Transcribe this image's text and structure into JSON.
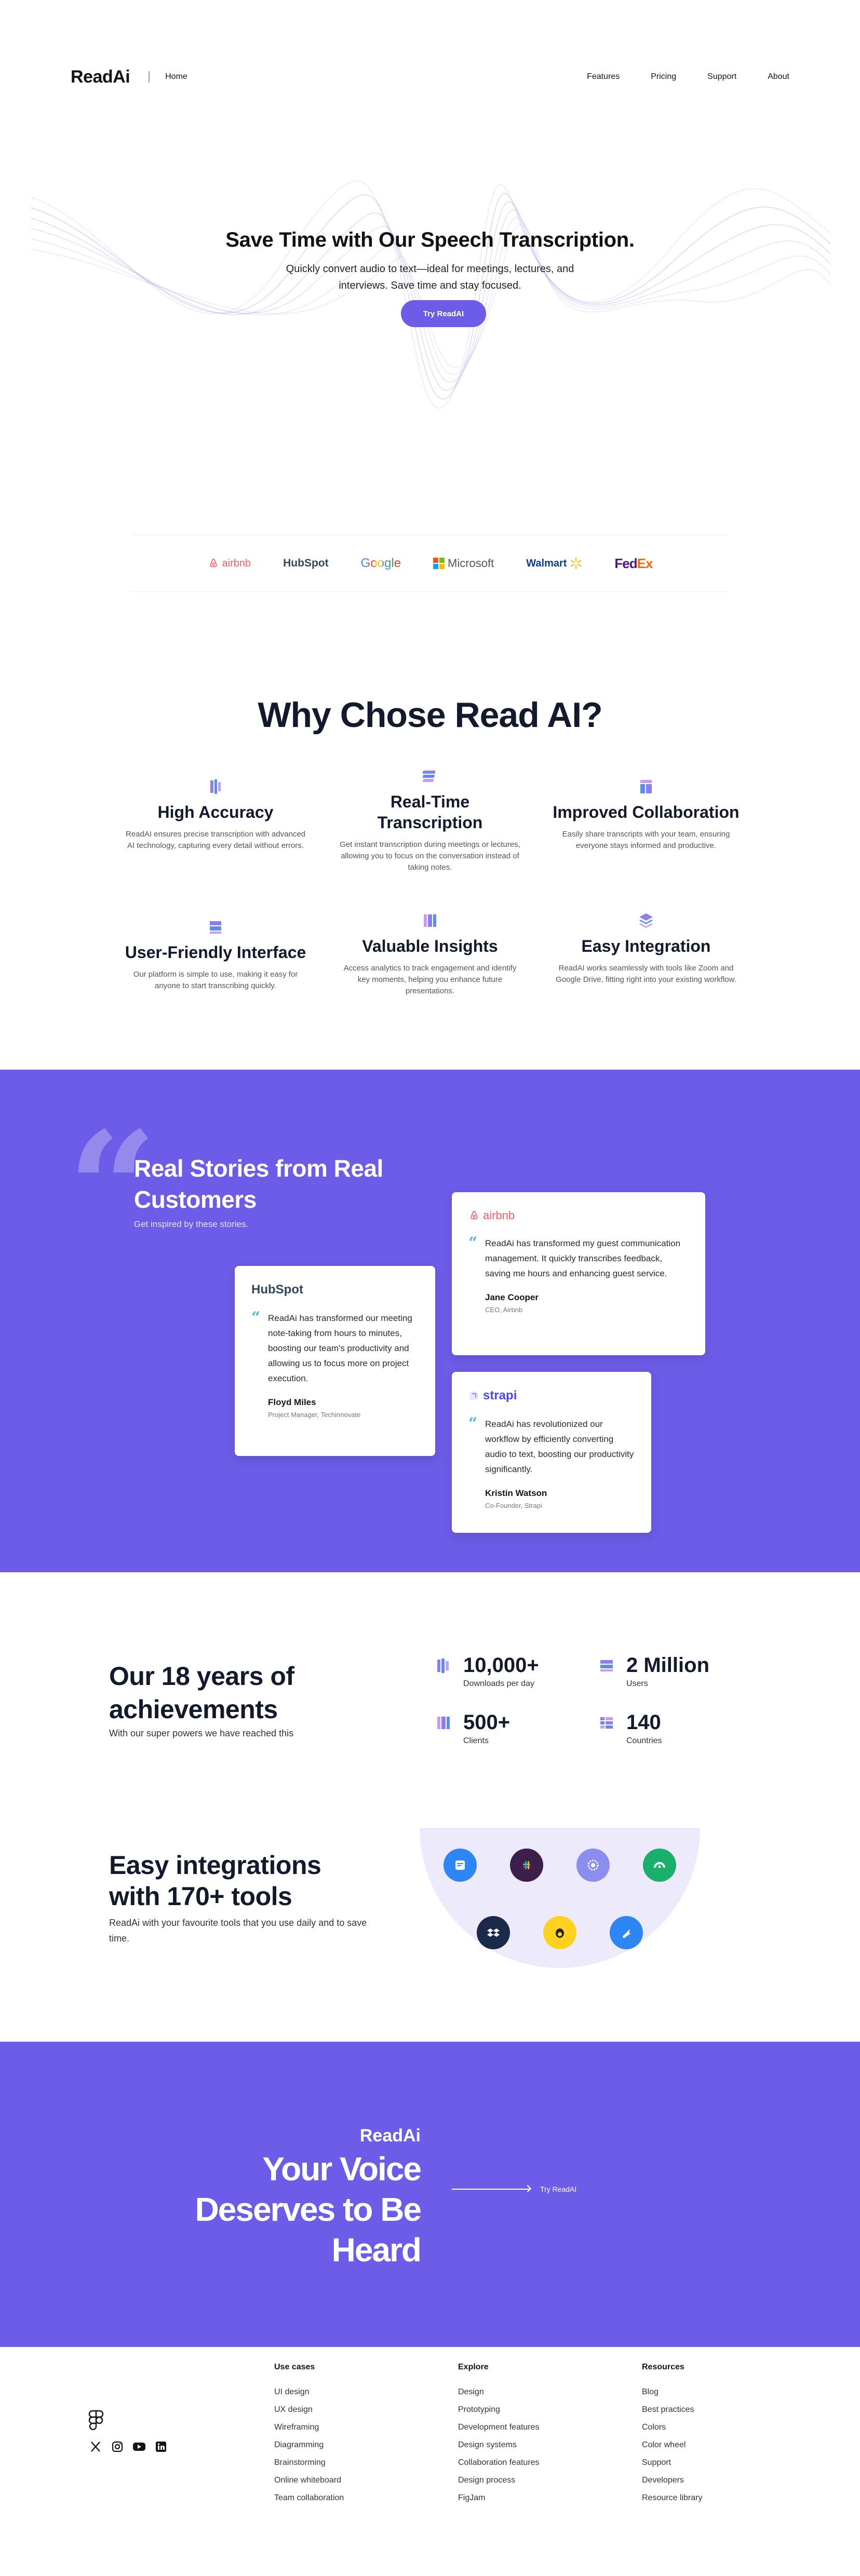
{
  "nav": {
    "logo": "ReadAi",
    "home": "Home",
    "links": [
      "Features",
      "Pricing",
      "Support",
      "About"
    ]
  },
  "hero": {
    "title": "Save Time with Our Speech Transcription.",
    "subtitle": "Quickly convert audio to text—ideal for meetings, lectures, and interviews. Save time and stay focused.",
    "cta": "Try ReadAI"
  },
  "logos": [
    "airbnb",
    "HubSpot",
    "Google",
    "Microsoft",
    "Walmart",
    "FedEx"
  ],
  "why": {
    "title": "Why Chose Read AI?",
    "features": [
      {
        "title": "High Accuracy",
        "text": "ReadAI ensures precise transcription with advanced AI technology, capturing every detail without errors."
      },
      {
        "title": "Real-Time Transcription",
        "text": "Get instant transcription during meetings or lectures, allowing you to focus on the conversation instead of taking notes."
      },
      {
        "title": "Improved Collaboration",
        "text": "Easily share transcripts with your team, ensuring everyone stays informed and productive."
      },
      {
        "title": "User-Friendly Interface",
        "text": "Our platform is simple to use, making it easy for anyone to start transcribing quickly."
      },
      {
        "title": "Valuable Insights",
        "text": "Access analytics to track engagement and identify key moments, helping you enhance future presentations."
      },
      {
        "title": "Easy Integration",
        "text": "ReadAI works seamlessly with tools like Zoom and Google Drive, fitting right into your existing workflow."
      }
    ]
  },
  "stories": {
    "title": "Real Stories from Real Customers",
    "subtitle": "Get inspired by these stories.",
    "testimonials": [
      {
        "brand": "HubSpot",
        "text": "ReadAi has transformed our meeting note-taking from hours to minutes, boosting our team's productivity and allowing us to focus more on project execution.",
        "name": "Floyd Miles",
        "role": "Project Manager, Techinnovate"
      },
      {
        "brand": "airbnb",
        "text": "ReadAi has transformed my guest communication management. It quickly transcribes feedback, saving me hours and enhancing guest service.",
        "name": "Jane Cooper",
        "role": "CEO, Airbnb"
      },
      {
        "brand": "strapi",
        "text": "ReadAi has revolutionized our workflow by efficiently converting audio to text, boosting our productivity significantly.",
        "name": "Kristin Watson",
        "role": "Co-Founder, Strapi"
      }
    ]
  },
  "achievements": {
    "title": "Our 18 years of achievements",
    "subtitle": "With our super powers we have reached this",
    "stats": [
      {
        "value": "10,000+",
        "label": "Downloads per day"
      },
      {
        "value": "2 Million",
        "label": "Users"
      },
      {
        "value": "500+",
        "label": "Clients"
      },
      {
        "value": "140",
        "label": "Countries"
      }
    ]
  },
  "integrations": {
    "title": "Easy integrations with 170+ tools",
    "subtitle": "ReadAi with your favourite tools that you use daily and to save time.",
    "tools": [
      "calendar-tool",
      "slack",
      "gear-tool",
      "cloud-tool",
      "dropbox",
      "mailchimp",
      "bolt-tool"
    ],
    "tool_colors": [
      "#2e86f5",
      "#3d1f4b",
      "#8b8df0",
      "#1aaf6c",
      "#1b2a4a",
      "#ffd21f",
      "#2e86f5"
    ]
  },
  "cta": {
    "brand": "ReadAi",
    "title": "Your Voice Deserves to Be Heard",
    "link": "Try ReadAI"
  },
  "footer": {
    "columns": [
      {
        "title": "Use cases",
        "items": [
          "UI design",
          "UX design",
          "Wireframing",
          "Diagramming",
          "Brainstorming",
          "Online whiteboard",
          "Team collaboration"
        ]
      },
      {
        "title": "Explore",
        "items": [
          "Design",
          "Prototyping",
          "Development features",
          "Design systems",
          "Collaboration features",
          "Design process",
          "FigJam"
        ]
      },
      {
        "title": "Resources",
        "items": [
          "Blog",
          "Best practices",
          "Colors",
          "Color wheel",
          "Support",
          "Developers",
          "Resource library"
        ]
      }
    ]
  },
  "colors": {
    "accent": "#6c5ce7",
    "dark": "#141a2e"
  }
}
